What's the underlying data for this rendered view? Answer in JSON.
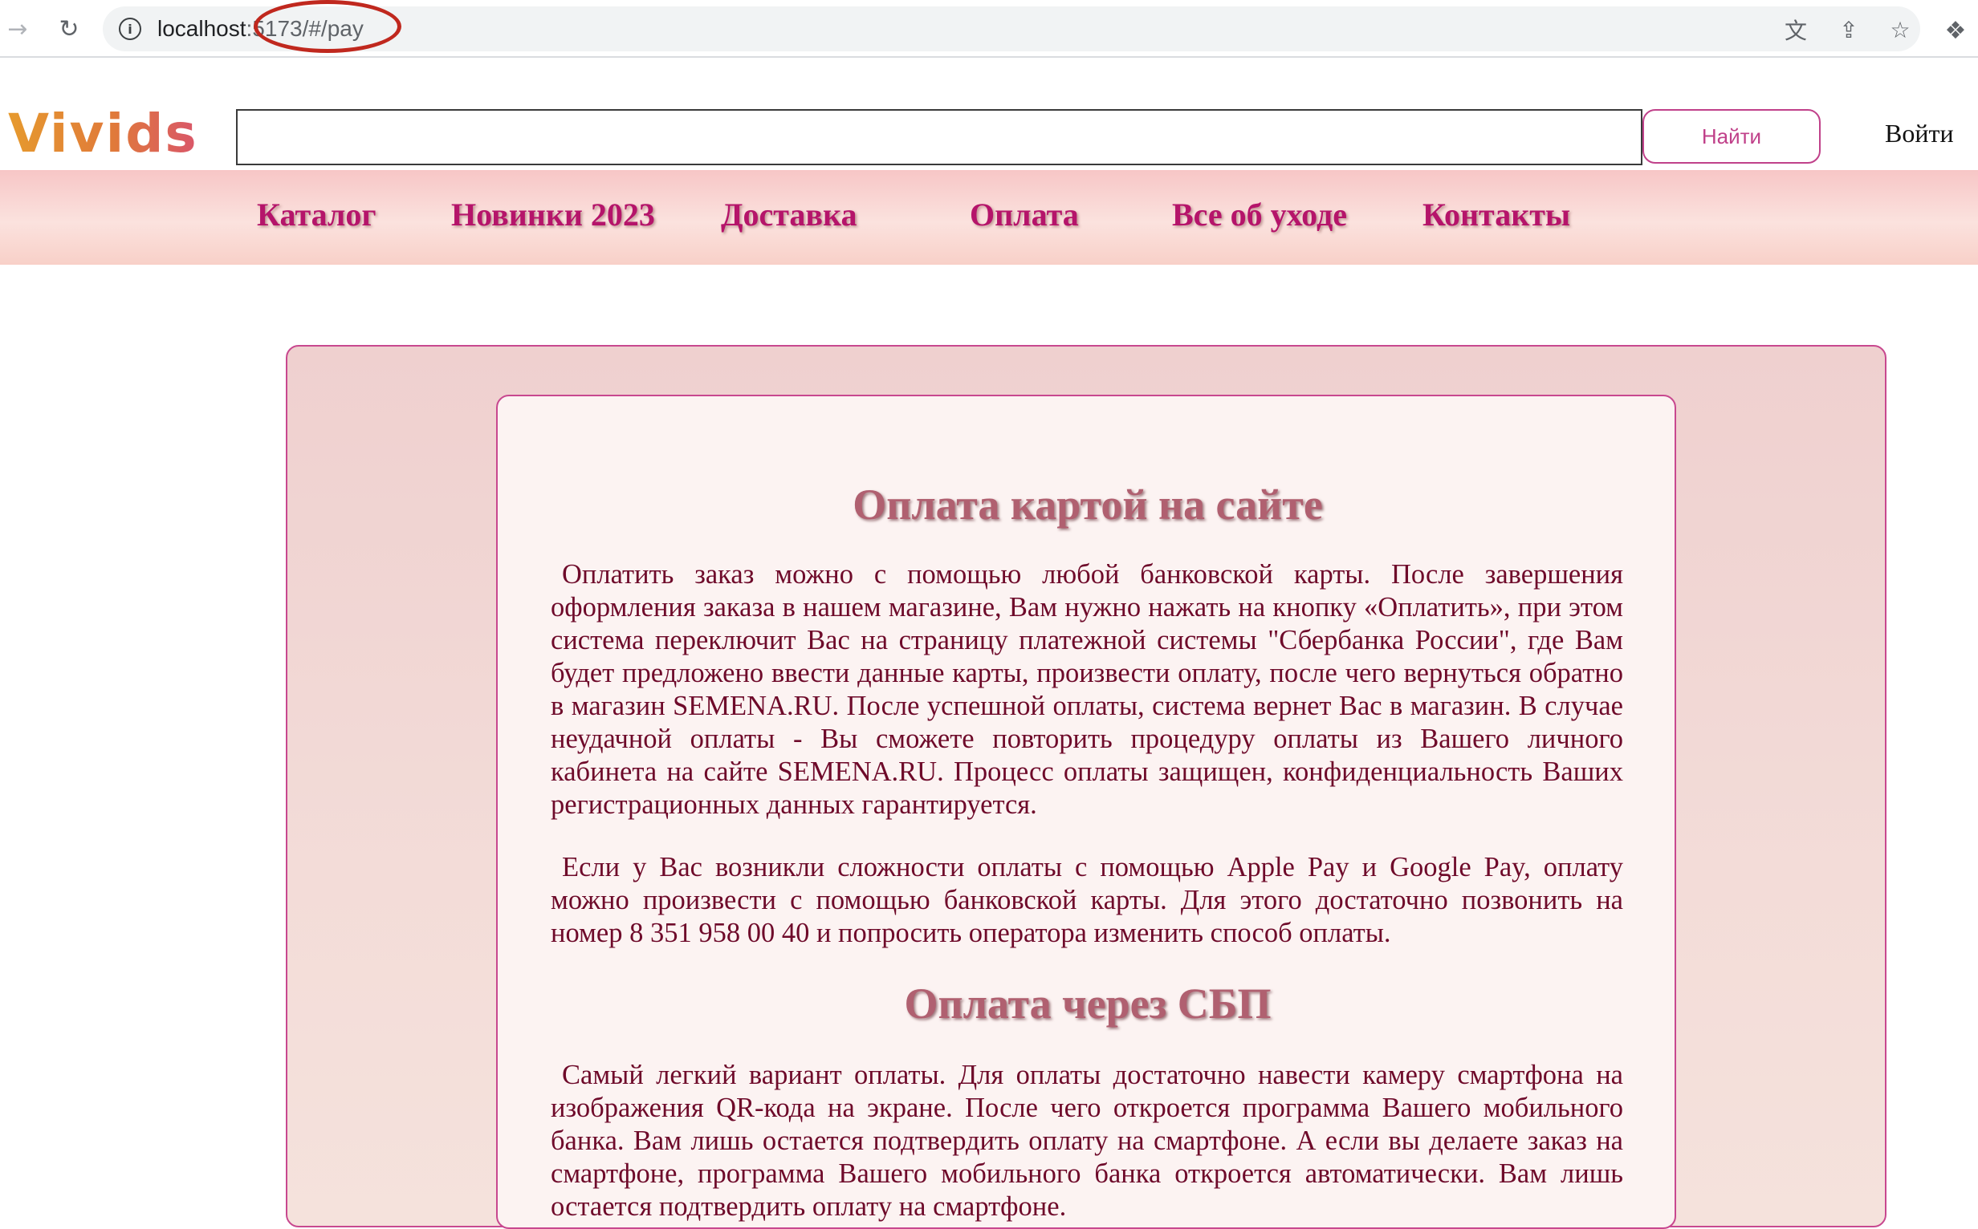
{
  "browser": {
    "url_host": "localhost",
    "url_rest": ":5173/#/pay",
    "icons": {
      "back": "arrow-left-icon",
      "reload": "reload-icon",
      "info": "info-icon",
      "translate": "translate-icon",
      "share": "share-icon",
      "bookmark": "star-icon",
      "extensions": "puzzle-icon"
    }
  },
  "header": {
    "logo": "Vivids",
    "search": {
      "value": "",
      "placeholder": ""
    },
    "search_button": "Найти",
    "login": "Войти"
  },
  "nav": {
    "items": [
      {
        "label": "Каталог"
      },
      {
        "label": "Новинки 2023"
      },
      {
        "label": "Доставка"
      },
      {
        "label": "Оплата"
      },
      {
        "label": "Все об уходе"
      },
      {
        "label": "Контакты"
      }
    ]
  },
  "content": {
    "section1": {
      "title": "Оплата картой на сайте",
      "p1": "Оплатить заказ можно с помощью любой банковской карты. После завершения оформления заказа в нашем магазине, Вам нужно нажать на кнопку «Оплатить», при этом система переключит Вас на страницу платежной системы \"Сбербанка России\", где Вам будет предложено ввести данные карты, произвести оплату, после чего вернуться обратно в магазин SEMENA.RU. После успешной оплаты, система вернет Вас в магазин. В случае неудачной оплаты - Вы сможете повторить процедуру оплаты из Вашего личного кабинета на сайте SEMENA.RU. Процесс оплаты защищен, конфиденциальность Ваших регистрационных данных гарантируется.",
      "p2": "Если у Вас возникли сложности оплаты с помощью Apple Pay и Google Pay, оплату можно произвести с помощью банковской карты. Для этого достаточно позвонить на номер 8 351 958 00 40 и попросить оператора изменить способ оплаты."
    },
    "section2": {
      "title": "Оплата через СБП",
      "p1": "Самый легкий вариант оплаты. Для оплаты достаточно навести камеру смартфона на изображения QR-кода на экране. После чего откроется программа Вашего мобильного банка. Вам лишь остается подтвердить оплату на смартфоне. А если вы делаете заказ на смартфоне, программа Вашего мобильного банка откроется автоматически. Вам лишь остается подтвердить оплату на смартфоне."
    }
  },
  "colors": {
    "brand_pink": "#b5146a",
    "text_dark_red": "#6e0a2a",
    "border_pink": "#c8488f",
    "annotation_red": "#c0281e"
  }
}
